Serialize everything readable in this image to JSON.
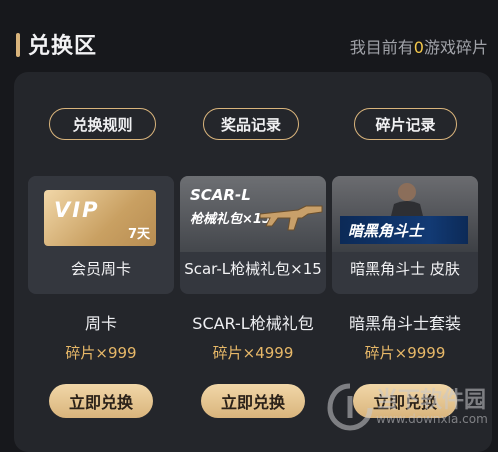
{
  "header": {
    "title": "兑换区",
    "fragment_prefix": "我目前有",
    "fragment_count": "0",
    "fragment_suffix": "游戏碎片"
  },
  "tabs": [
    {
      "label": "兑换规则"
    },
    {
      "label": "奖品记录"
    },
    {
      "label": "碎片记录"
    }
  ],
  "items": [
    {
      "image_text_main": "VIP",
      "image_text_sub": "7天",
      "caption": "会员周卡",
      "name": "周卡",
      "price": "碎片×999",
      "action": "立即兑换"
    },
    {
      "image_text_main": "SCAR-L",
      "image_text_sub": "枪械礼包×15",
      "caption": "Scar-L枪械礼包×15",
      "name": "SCAR-L枪械礼包",
      "price": "碎片×4999",
      "action": "立即兑换"
    },
    {
      "image_text_main": "暗黑角斗士",
      "caption": "暗黑角斗士 皮肤",
      "name": "暗黑角斗士套装",
      "price": "碎片×9999",
      "action": "立即兑换"
    }
  ],
  "watermark": {
    "name": "当下软件园",
    "url": "www.downxia.com"
  },
  "colors": {
    "accent_gold": "#d9b47c",
    "price_gold": "#e7b868",
    "count_yellow": "#f3c74a",
    "bg": "#17181c",
    "panel": "#24262b"
  }
}
